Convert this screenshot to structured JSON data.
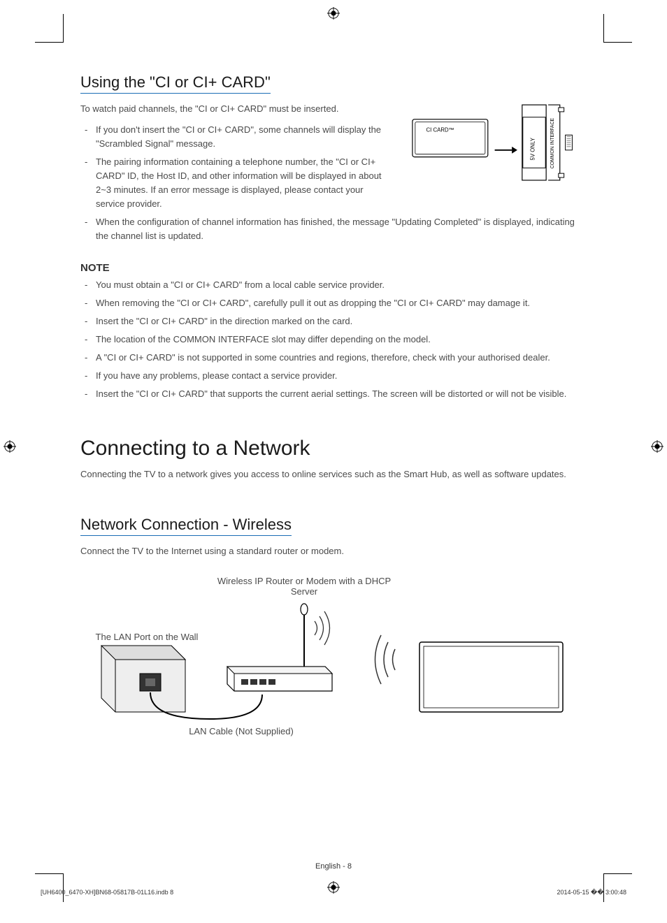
{
  "section1": {
    "heading": "Using the \"CI or CI+ CARD\"",
    "intro": "To watch paid channels, the \"CI or CI+ CARD\" must be inserted.",
    "bullets": [
      "If you don't insert the \"CI or CI+ CARD\", some channels will display the \"Scrambled Signal\" message.",
      "The pairing information containing a telephone number, the \"CI or CI+ CARD\" ID, the Host ID, and other information will be displayed in about 2~3 minutes. If an error message is displayed, please contact your service provider.",
      "When the configuration of channel information has finished, the message \"Updating Completed\" is displayed, indicating the channel list is updated."
    ],
    "figure": {
      "card_label": "CI CARD™",
      "slot_label1": "5V ONLY",
      "slot_label2": "COMMON INTERFACE"
    }
  },
  "note": {
    "heading": "NOTE",
    "bullets": [
      "You must obtain a \"CI or CI+ CARD\" from a local cable service provider.",
      "When removing the \"CI or CI+ CARD\", carefully pull it out as dropping the \"CI or CI+ CARD\" may damage it.",
      "Insert the \"CI or CI+ CARD\" in the direction marked on the card.",
      "The location of the COMMON INTERFACE slot may differ depending on the model.",
      "A \"CI or CI+ CARD\" is not supported in some countries and regions, therefore, check with your authorised dealer.",
      "If you have any problems, please contact a service provider.",
      "Insert the \"CI or CI+ CARD\" that supports the current aerial settings. The screen will be distorted or will not be visible."
    ]
  },
  "section2": {
    "heading": "Connecting to a Network",
    "intro": "Connecting the TV to a network gives you access to online services such as the Smart Hub, as well as software updates."
  },
  "section3": {
    "heading": "Network Connection - Wireless",
    "intro": "Connect the TV to the Internet using a standard router or modem.",
    "diagram": {
      "router_label": "Wireless IP Router or Modem with a DHCP Server",
      "wall_label": "The LAN Port on the Wall",
      "cable_label": "LAN Cable (Not Supplied)"
    }
  },
  "footer": {
    "page": "English - 8",
    "file": "[UH6400_6470-XH]BN68-05817B-01L16.indb   8",
    "timestamp": "2014-05-15   �� 3:00:48"
  }
}
